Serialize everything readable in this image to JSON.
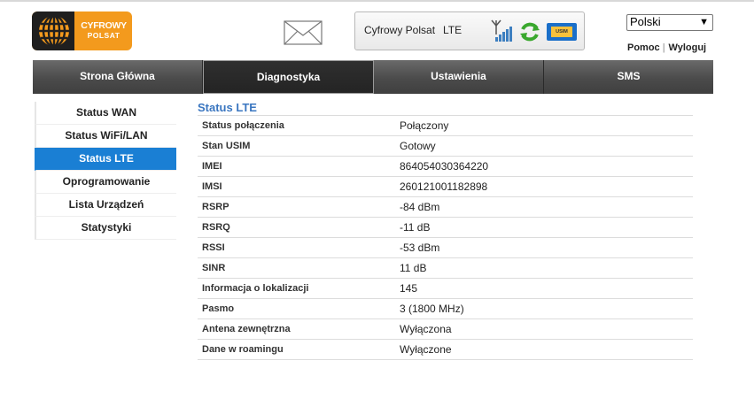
{
  "logo": {
    "line1": "CYFROWY",
    "line2": "POLSAT"
  },
  "status": {
    "provider": "Cyfrowy Polsat",
    "network": "LTE",
    "sim_label": "USIM"
  },
  "language": {
    "selected": "Polski"
  },
  "top_links": {
    "help": "Pomoc",
    "separator": "|",
    "logout": "Wyloguj"
  },
  "nav": {
    "tabs": [
      {
        "label": "Strona Główna",
        "active": false
      },
      {
        "label": "Diagnostyka",
        "active": true
      },
      {
        "label": "Ustawienia",
        "active": false
      },
      {
        "label": "SMS",
        "active": false
      }
    ]
  },
  "sidebar": {
    "items": [
      {
        "label": "Status WAN"
      },
      {
        "label": "Status WiFi/LAN"
      },
      {
        "label": "Status LTE",
        "active": true
      },
      {
        "label": "Oprogramowanie"
      },
      {
        "label": "Lista Urządzeń"
      },
      {
        "label": "Statystyki"
      }
    ]
  },
  "main": {
    "title": "Status LTE",
    "rows": [
      {
        "key": "Status połączenia",
        "value": "Połączony"
      },
      {
        "key": "Stan USIM",
        "value": "Gotowy"
      },
      {
        "key": "IMEI",
        "value": "864054030364220"
      },
      {
        "key": "IMSI",
        "value": "260121001182898"
      },
      {
        "key": "RSRP",
        "value": "-84 dBm"
      },
      {
        "key": "RSRQ",
        "value": "-11 dB"
      },
      {
        "key": "RSSI",
        "value": "-53 dBm"
      },
      {
        "key": "SINR",
        "value": "11 dB"
      },
      {
        "key": "Informacja o lokalizacji",
        "value": "145"
      },
      {
        "key": "Pasmo",
        "value": "3 (1800 MHz)"
      },
      {
        "key": "Antena zewnętrzna",
        "value": "Wyłączona"
      },
      {
        "key": "Dane w roamingu",
        "value": "Wyłączone"
      }
    ]
  },
  "colors": {
    "accent": "#1a7fd4",
    "brand": "#f39a1d",
    "title": "#3a76c0"
  },
  "icons": [
    "globe-logo-icon",
    "envelope-icon",
    "signal-icon",
    "refresh-icon",
    "sim-card-icon",
    "chevron-down-icon"
  ]
}
